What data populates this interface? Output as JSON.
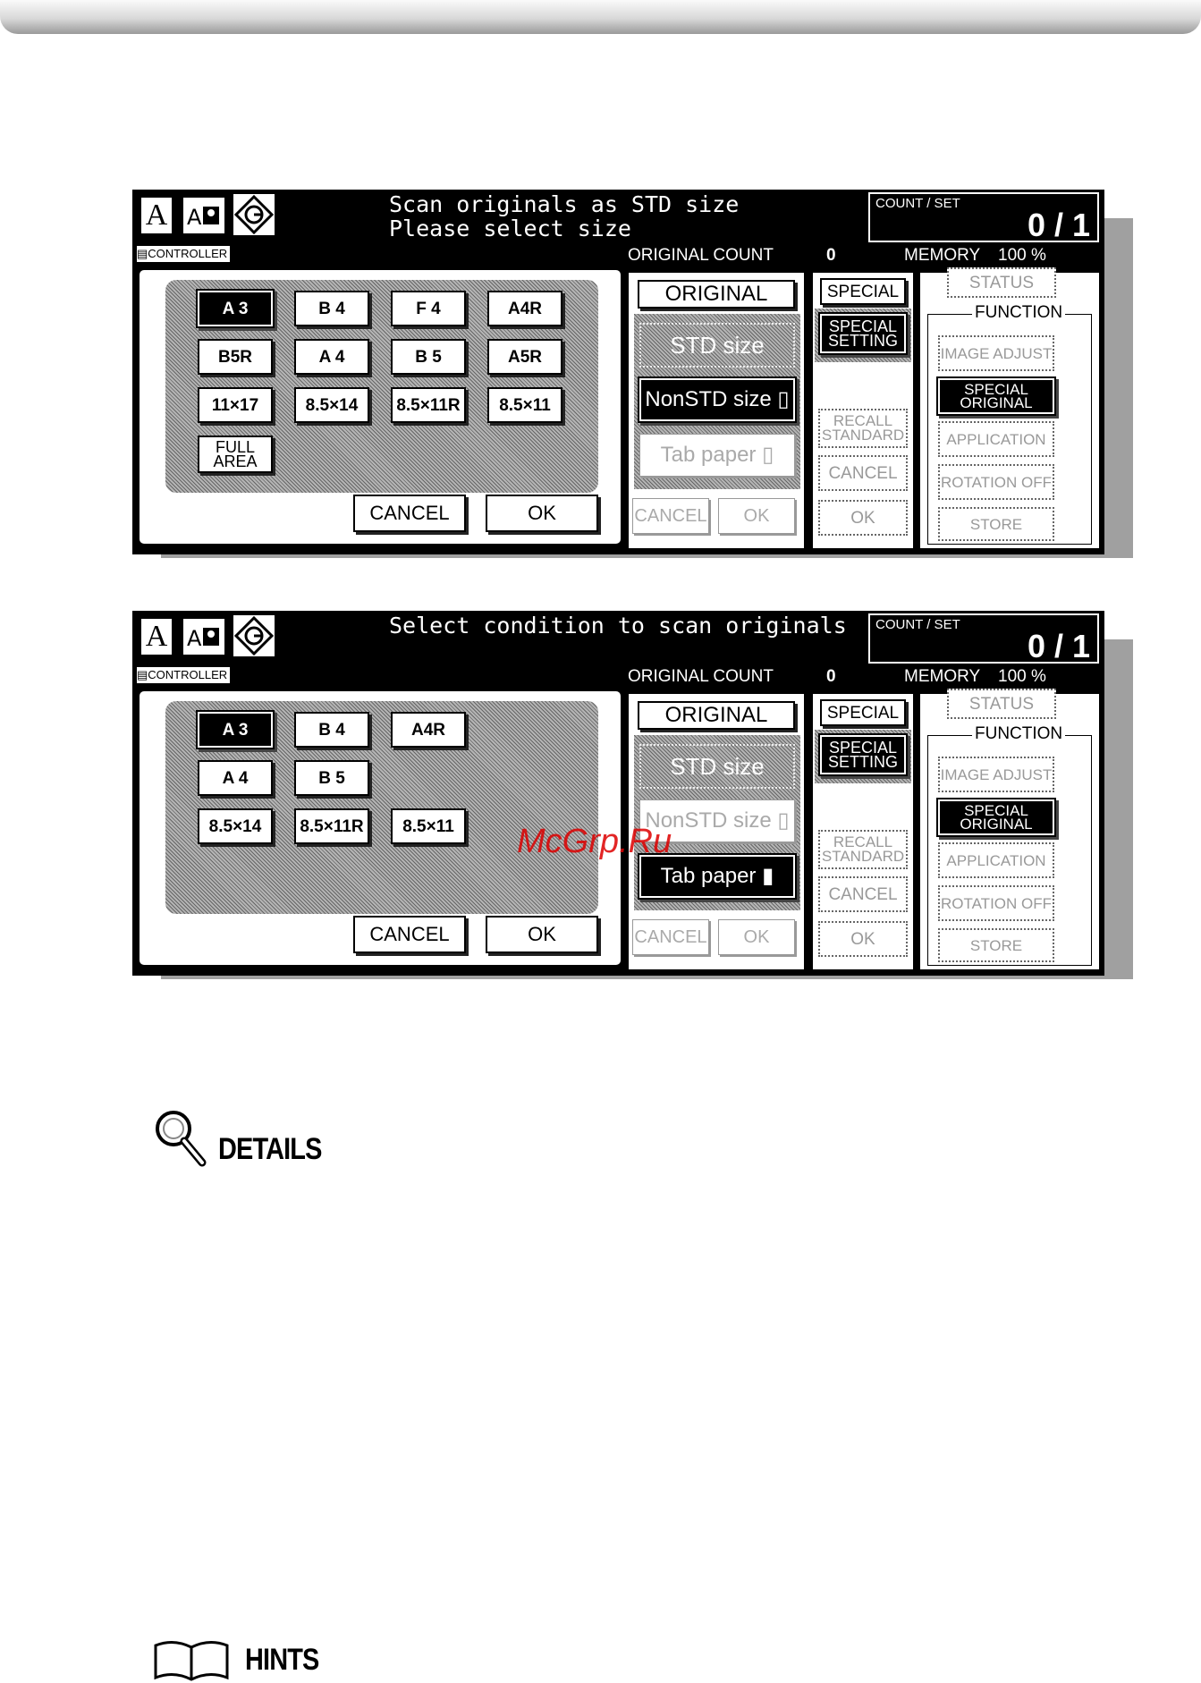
{
  "panel1": {
    "message": [
      "Scan originals as STD size",
      "Please select size"
    ],
    "count_label": "COUNT / SET",
    "count_value": "0 / 1",
    "controller": "CONTROLLER",
    "original_count_label": "ORIGINAL COUNT",
    "original_count_value": "0",
    "memory_label": "MEMORY",
    "memory_value": "100 %",
    "sizes": [
      "A 3",
      "B 4",
      "F 4",
      "A4R",
      "B5R",
      "A 4",
      "B 5",
      "A5R",
      "11×17",
      "8.5×14",
      "8.5×11R",
      "8.5×11",
      "FULL AREA"
    ],
    "cancel": "CANCEL",
    "ok": "OK",
    "original_tab": "ORIGINAL",
    "std_size": "STD size",
    "nonstd_size": "NonSTD size",
    "tab_paper": "Tab paper",
    "cancel_small": "CANCEL",
    "ok_small": "OK",
    "special_tab": "SPECIAL",
    "special_setting": "SPECIAL SETTING",
    "recall_standard": "RECALL STANDARD",
    "cancel_mid": "CANCEL",
    "ok_mid": "OK",
    "status": "STATUS",
    "function_label": "FUNCTION",
    "image_adjust": "IMAGE ADJUST",
    "special_original": "SPECIAL ORIGINAL",
    "application": "APPLICATION",
    "rotation_off": "ROTATION OFF",
    "store": "STORE"
  },
  "panel2": {
    "message": [
      "Select condition to scan originals"
    ],
    "count_label": "COUNT / SET",
    "count_value": "0 / 1",
    "controller": "CONTROLLER",
    "original_count_label": "ORIGINAL COUNT",
    "original_count_value": "0",
    "memory_label": "MEMORY",
    "memory_value": "100 %",
    "sizes": [
      "A 3",
      "B 4",
      "A4R",
      "A 4",
      "B 5",
      "8.5×14",
      "8.5×11R",
      "8.5×11"
    ],
    "cancel": "CANCEL",
    "ok": "OK",
    "original_tab": "ORIGINAL",
    "std_size": "STD size",
    "nonstd_size": "NonSTD size",
    "tab_paper": "Tab paper",
    "cancel_small": "CANCEL",
    "ok_small": "OK",
    "special_tab": "SPECIAL",
    "special_setting": "SPECIAL SETTING",
    "recall_standard": "RECALL STANDARD",
    "cancel_mid": "CANCEL",
    "ok_mid": "OK",
    "status": "STATUS",
    "function_label": "FUNCTION",
    "image_adjust": "IMAGE ADJUST",
    "special_original": "SPECIAL ORIGINAL",
    "application": "APPLICATION",
    "rotation_off": "ROTATION OFF",
    "store": "STORE"
  },
  "watermark": "McGrp.Ru",
  "details_label": "DETAILS",
  "hints_label": "HINTS"
}
